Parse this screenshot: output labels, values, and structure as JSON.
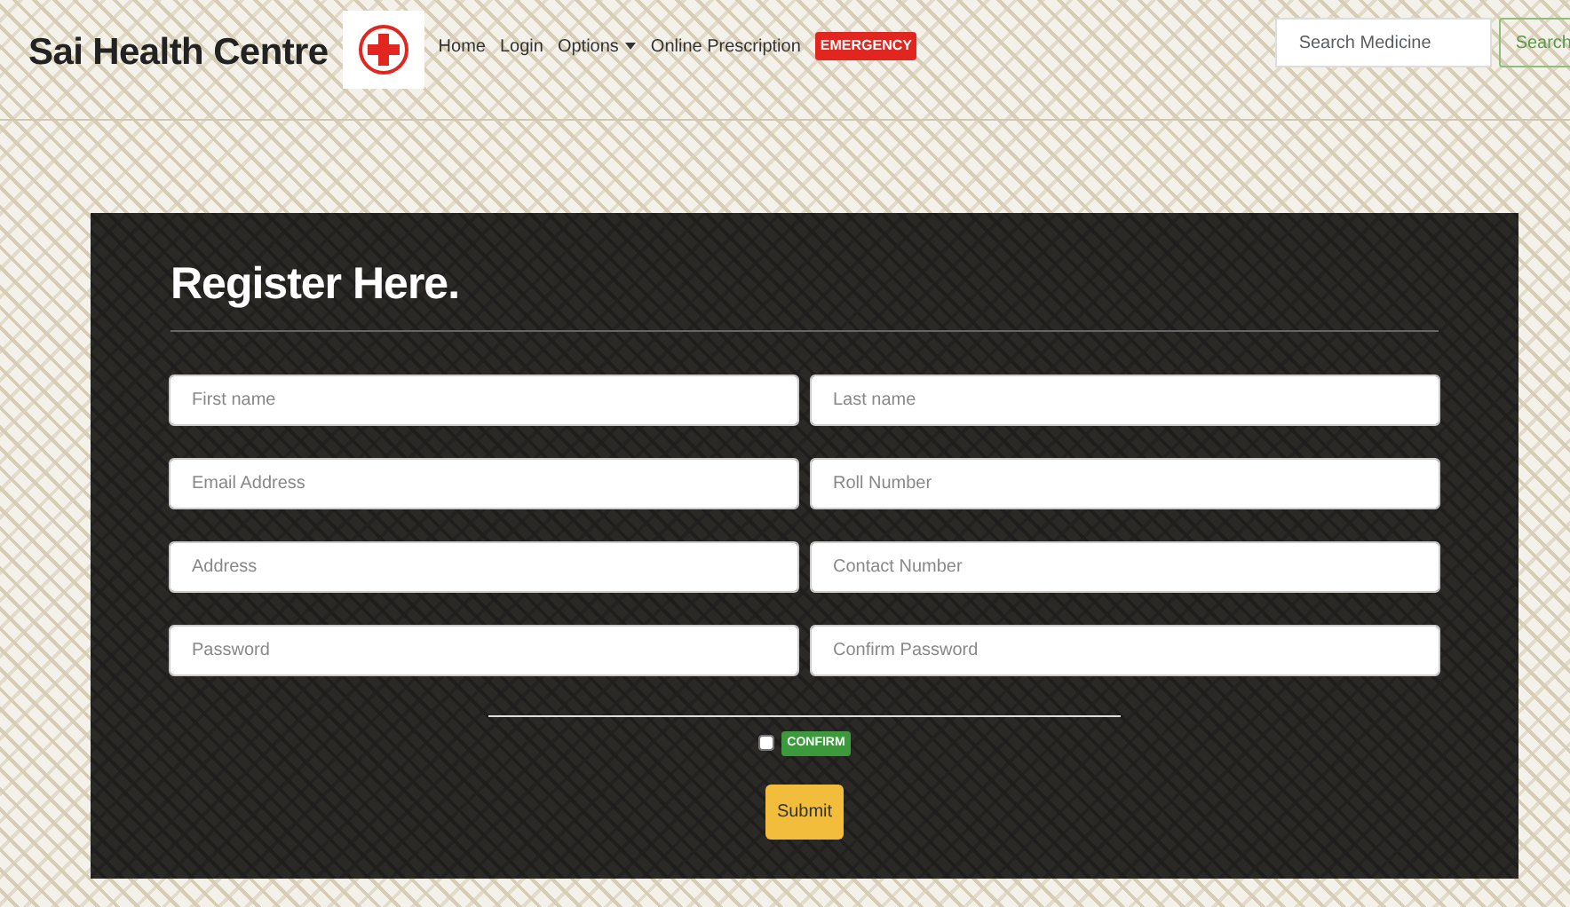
{
  "brand": "Sai Health Centre",
  "nav": [
    {
      "label": "Home",
      "kind": "link"
    },
    {
      "label": "Login",
      "kind": "link"
    },
    {
      "label": "Options",
      "kind": "dropdown"
    },
    {
      "label": "Online Prescription",
      "kind": "link"
    },
    {
      "label": "EMERGENCY",
      "kind": "badge"
    }
  ],
  "search": {
    "placeholder": "Search Medicine",
    "button": "Search"
  },
  "form": {
    "title": "Register Here.",
    "fields": [
      {
        "placeholder": "First name"
      },
      {
        "placeholder": "Last name"
      },
      {
        "placeholder": "Email Address"
      },
      {
        "placeholder": "Roll Number"
      },
      {
        "placeholder": "Address"
      },
      {
        "placeholder": "Contact Number"
      },
      {
        "placeholder": "Password"
      },
      {
        "placeholder": "Confirm Password"
      }
    ],
    "confirm": {
      "label": "CONFIRM",
      "checked": false
    },
    "submit": "Submit"
  }
}
